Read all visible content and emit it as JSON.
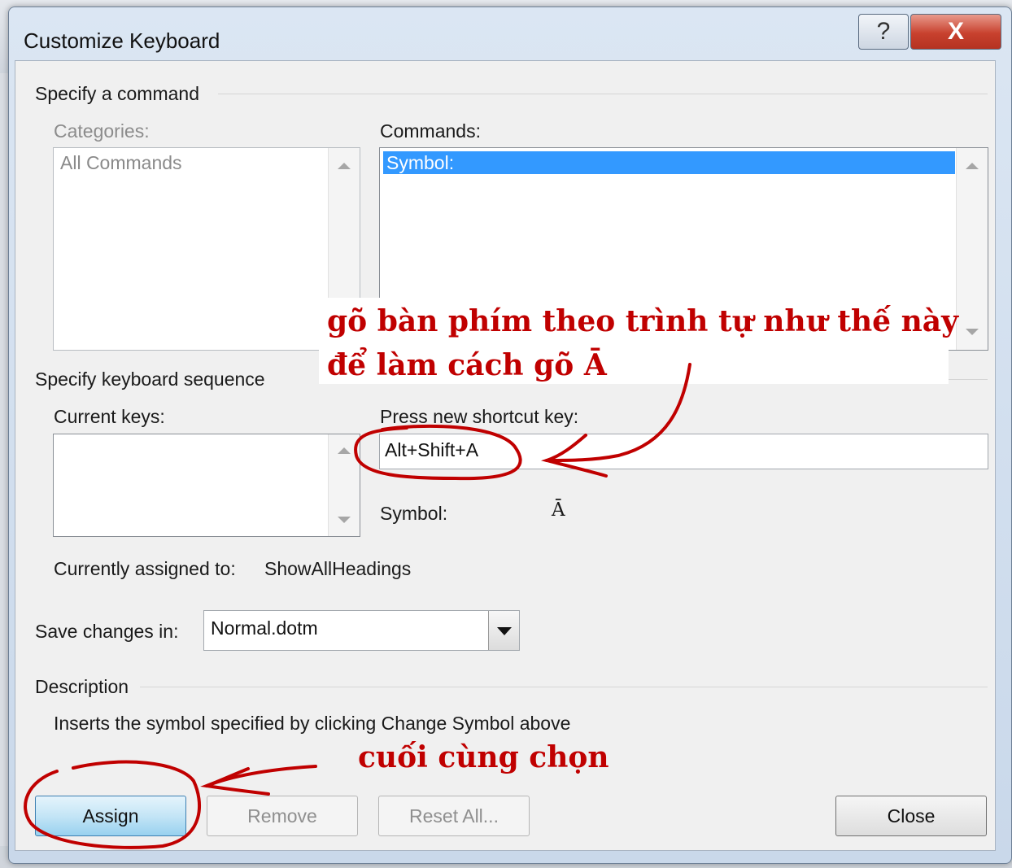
{
  "dialog": {
    "title": "Customize Keyboard",
    "help_icon_glyph": "?",
    "close_icon_glyph": "X"
  },
  "specify_command": {
    "group_label": "Specify a command",
    "categories_label": "Categories:",
    "categories_items": [
      "All Commands"
    ],
    "commands_label": "Commands:",
    "commands_items": [
      "Symbol:"
    ]
  },
  "keyboard_sequence": {
    "group_label": "Specify keyboard sequence",
    "current_keys_label": "Current keys:",
    "press_new_label": "Press new shortcut key:",
    "new_shortcut_value": "Alt+Shift+A",
    "symbol_label": "Symbol:",
    "symbol_value": "Ā"
  },
  "assignment": {
    "label": "Currently assigned to:",
    "value": "ShowAllHeadings"
  },
  "save_changes": {
    "label": "Save changes in:",
    "value": "Normal.dotm"
  },
  "description": {
    "group_label": "Description",
    "text": "Inserts the symbol specified by clicking Change Symbol above"
  },
  "buttons": {
    "assign": "Assign",
    "remove": "Remove",
    "reset_all": "Reset All...",
    "close": "Close"
  },
  "annotations": {
    "line1": "gõ bàn phím theo trình tự như thế này",
    "line2": "để làm cách gõ Ā",
    "bottom": "cuối cùng chọn",
    "color": "#c00000"
  },
  "colors": {
    "selection": "#3399ff",
    "annotation": "#c00000"
  }
}
